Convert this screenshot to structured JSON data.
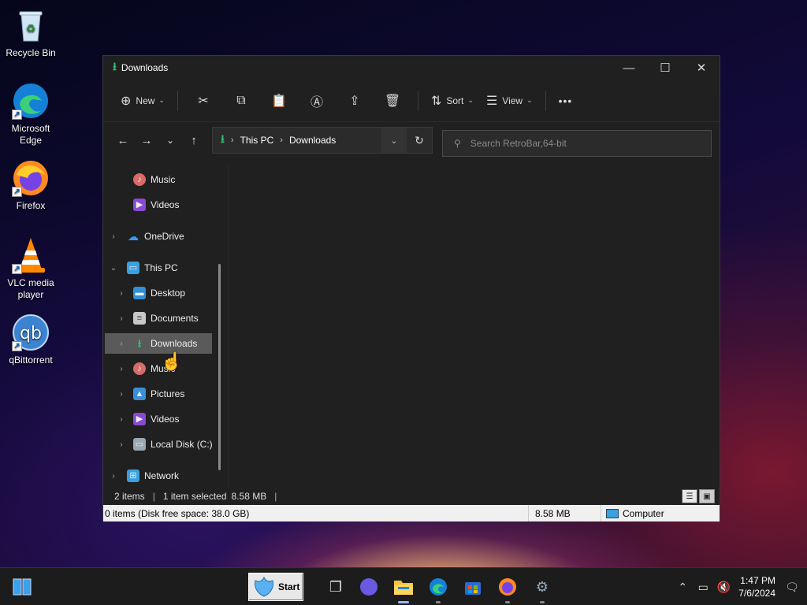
{
  "desktop": {
    "icons": [
      {
        "label": "Recycle Bin",
        "icon": "recycle-bin-icon"
      },
      {
        "label": "Microsoft Edge",
        "icon": "edge-icon"
      },
      {
        "label": "Firefox",
        "icon": "firefox-icon"
      },
      {
        "label": "VLC media player",
        "icon": "vlc-icon"
      },
      {
        "label": "qBittorrent",
        "icon": "qbittorrent-icon"
      }
    ]
  },
  "window": {
    "title": "Downloads",
    "controls": {
      "minimize": "—",
      "maximize": "☐",
      "close": "✕"
    }
  },
  "toolbar": {
    "new_label": "New",
    "sort_label": "Sort",
    "view_label": "View",
    "more": "•••",
    "icons": [
      "cut-icon",
      "copy-icon",
      "paste-icon",
      "rename-icon",
      "share-icon",
      "delete-icon"
    ]
  },
  "address": {
    "segments": [
      "This PC",
      "Downloads"
    ]
  },
  "search": {
    "placeholder": "Search RetroBar,64-bit"
  },
  "navpane": {
    "items": [
      {
        "label": "Music",
        "icon": "music-icon"
      },
      {
        "label": "Videos",
        "icon": "videos-icon"
      },
      {
        "label": "OneDrive",
        "icon": "onedrive-icon"
      },
      {
        "label": "This PC",
        "icon": "this-pc-icon"
      },
      {
        "label": "Desktop",
        "icon": "desktop-icon"
      },
      {
        "label": "Documents",
        "icon": "documents-icon"
      },
      {
        "label": "Downloads",
        "icon": "downloads-icon",
        "selected": true
      },
      {
        "label": "Music",
        "icon": "music-icon"
      },
      {
        "label": "Pictures",
        "icon": "pictures-icon"
      },
      {
        "label": "Videos",
        "icon": "videos-icon"
      },
      {
        "label": "Local Disk (C:)",
        "icon": "local-disk-icon"
      },
      {
        "label": "Network",
        "icon": "network-icon"
      }
    ]
  },
  "status": {
    "items_count": "2 items",
    "selection": "1 item selected",
    "selected_size": "8.58 MB"
  },
  "classic_status": {
    "info": "0 items (Disk free space: 38.0 GB)",
    "size": "8.58 MB",
    "zone": "Computer"
  },
  "taskbar": {
    "start_label": "Start",
    "clock_time": "1:47 PM",
    "clock_date": "7/6/2024"
  }
}
